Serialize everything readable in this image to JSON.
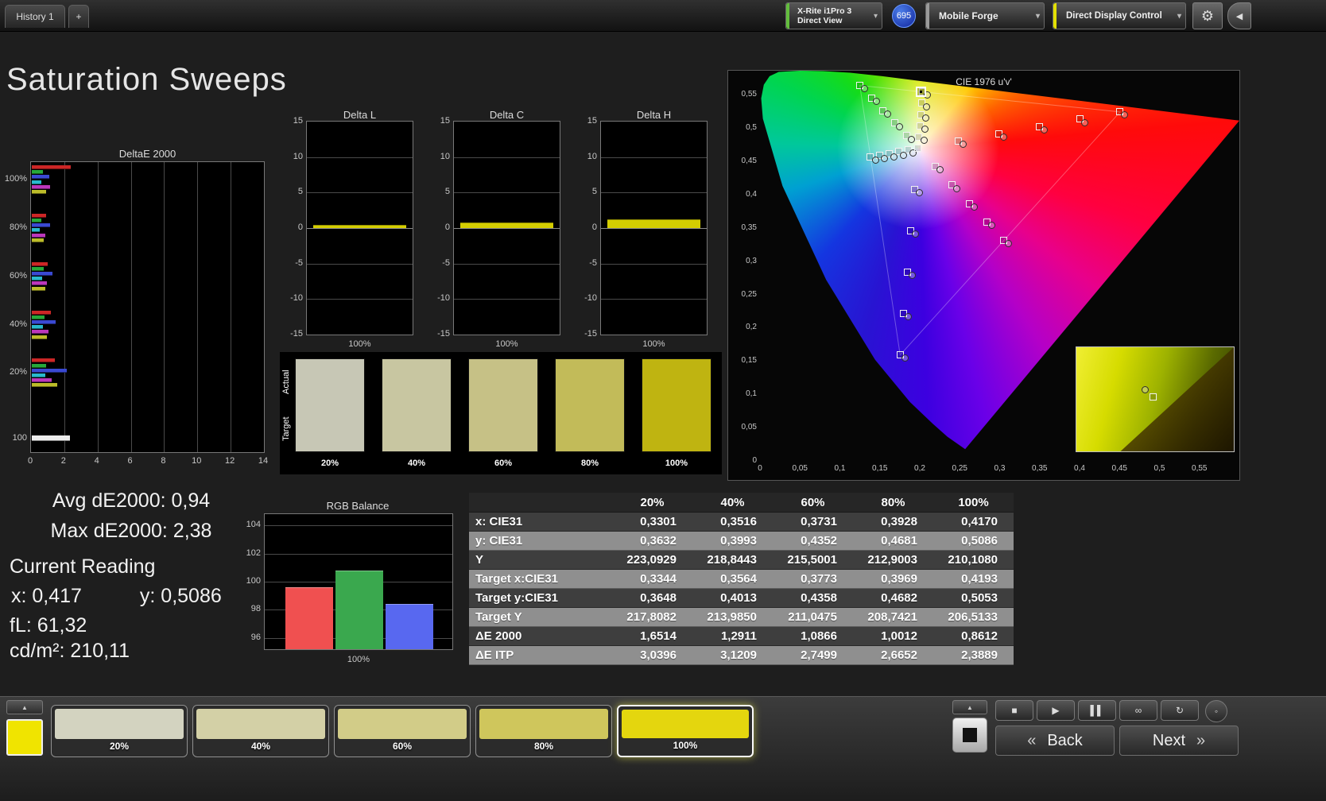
{
  "colors": {
    "meter_accent": "#62bd3c",
    "source_accent": "#9a9a9a",
    "workflow_accent": "#e3e000",
    "current_selection": "#f0e400"
  },
  "top_bar": {
    "tab": "History 1",
    "new_tab": "+",
    "meter_line1": "X-Rite i1Pro 3",
    "meter_line2": "Direct View",
    "badge": "695",
    "source": "Mobile Forge",
    "workflow": "Direct Display Control",
    "chevron": "▾",
    "gear": "⚙",
    "collapse": "◀"
  },
  "page_title": "Saturation Sweeps",
  "readings": {
    "avg": "Avg dE2000: 0,94",
    "max": "Max dE2000: 2,38",
    "current_title": "Current Reading",
    "x": "x: 0,417",
    "y": "y: 0,5086",
    "fl": "fL: 61,32",
    "cdm2": "cd/m²: 210,11"
  },
  "swatches": {
    "row_labels": [
      "Actual",
      "Target"
    ],
    "items": [
      {
        "label": "20%",
        "color": "#c7c7b5"
      },
      {
        "label": "40%",
        "color": "#c8c6a1"
      },
      {
        "label": "60%",
        "color": "#c6c186"
      },
      {
        "label": "80%",
        "color": "#c2bb59"
      },
      {
        "label": "100%",
        "color": "#bfb411"
      }
    ]
  },
  "chart_data": [
    {
      "id": "deltae2000",
      "type": "bar",
      "title": "DeltaE 2000",
      "orientation": "horizontal",
      "xlim": [
        0,
        14
      ],
      "xticks": [
        0,
        2,
        4,
        6,
        8,
        10,
        12,
        14
      ],
      "series_colors": [
        "#cc2626",
        "#27a839",
        "#3a49d2",
        "#28b9cc",
        "#bb37bb",
        "#bcbc29"
      ],
      "groups": [
        {
          "label": "100%",
          "values": [
            2.35,
            0.65,
            1.05,
            0.55,
            1.1,
            0.86
          ]
        },
        {
          "label": "80%",
          "values": [
            0.85,
            0.55,
            1.1,
            0.5,
            0.8,
            0.7
          ]
        },
        {
          "label": "60%",
          "values": [
            0.95,
            0.7,
            1.25,
            0.6,
            0.9,
            0.8
          ]
        },
        {
          "label": "40%",
          "values": [
            1.15,
            0.75,
            1.45,
            0.65,
            1.0,
            0.9
          ]
        },
        {
          "label": "20%",
          "values": [
            1.4,
            0.85,
            2.1,
            0.8,
            1.2,
            1.55
          ]
        },
        {
          "label": "100",
          "values": [
            2.3
          ],
          "colors": [
            "#ececec"
          ]
        }
      ]
    },
    {
      "id": "deltaL",
      "type": "bar",
      "title": "Delta L",
      "ylim": [
        -15,
        15
      ],
      "yticks": [
        15,
        10,
        5,
        0,
        -5,
        -10,
        -15
      ],
      "xlabel": "100%",
      "values": [
        0.4
      ],
      "bar_color": "#d4cd00"
    },
    {
      "id": "deltaC",
      "type": "bar",
      "title": "Delta C",
      "ylim": [
        -15,
        15
      ],
      "yticks": [
        15,
        10,
        5,
        0,
        -5,
        -10,
        -15
      ],
      "xlabel": "100%",
      "values": [
        0.8
      ],
      "bar_color": "#d4cd00"
    },
    {
      "id": "deltaH",
      "type": "bar",
      "title": "Delta H",
      "ylim": [
        -15,
        15
      ],
      "yticks": [
        15,
        10,
        5,
        0,
        -5,
        -10,
        -15
      ],
      "xlabel": "100%",
      "values": [
        1.2
      ],
      "bar_color": "#d4cd00"
    },
    {
      "id": "rgb_balance",
      "type": "bar",
      "title": "RGB Balance",
      "ylim": [
        95.2,
        104.8
      ],
      "yticks": [
        104,
        102,
        100,
        98,
        96
      ],
      "xlabel": "100%",
      "categories": [
        "Red",
        "Green",
        "Blue"
      ],
      "values": [
        99.6,
        100.8,
        98.4
      ],
      "colors": [
        "#f05050",
        "#3aa84e",
        "#5868f0"
      ]
    },
    {
      "id": "cie",
      "type": "scatter",
      "title": "CIE 1976 u'v'",
      "axis_ticks": [
        "0",
        "0,05",
        "0,1",
        "0,15",
        "0,2",
        "0,25",
        "0,3",
        "0,35",
        "0,4",
        "0,45",
        "0,5",
        "0,55"
      ],
      "u_range": [
        0,
        0.6
      ],
      "v_range": [
        0,
        0.585
      ],
      "white_point": {
        "u": 0.1978,
        "v": 0.4683
      },
      "sweeps": [
        {
          "name": "red",
          "points": [
            [
              0.2484,
              0.4792
            ],
            [
              0.299,
              0.4901
            ],
            [
              0.3495,
              0.5011
            ],
            [
              0.4001,
              0.512
            ],
            [
              0.4507,
              0.5229
            ]
          ]
        },
        {
          "name": "green",
          "points": [
            [
              0.1832,
              0.4871
            ],
            [
              0.1687,
              0.506
            ],
            [
              0.1541,
              0.5248
            ],
            [
              0.1396,
              0.5437
            ],
            [
              0.125,
              0.5625
            ]
          ]
        },
        {
          "name": "blue",
          "points": [
            [
              0.1933,
              0.4062
            ],
            [
              0.1888,
              0.3441
            ],
            [
              0.1844,
              0.2821
            ],
            [
              0.1799,
              0.22
            ],
            [
              0.1754,
              0.1579
            ]
          ]
        },
        {
          "name": "cyan",
          "points": [
            [
              0.1859,
              0.4657
            ],
            [
              0.174,
              0.4631
            ],
            [
              0.1621,
              0.4606
            ],
            [
              0.1502,
              0.458
            ],
            [
              0.1383,
              0.4554
            ]
          ]
        },
        {
          "name": "magenta",
          "points": [
            [
              0.2192,
              0.4406
            ],
            [
              0.2407,
              0.4129
            ],
            [
              0.2621,
              0.3851
            ],
            [
              0.2836,
              0.3574
            ],
            [
              0.305,
              0.3297
            ]
          ]
        },
        {
          "name": "yellow",
          "points": [
            [
              0.199,
              0.4852
            ],
            [
              0.2002,
              0.5021
            ],
            [
              0.2015,
              0.519
            ],
            [
              0.2027,
              0.536
            ],
            [
              0.2039,
              0.5529
            ]
          ]
        }
      ],
      "current": {
        "u": 0.2017,
        "v": 0.5535
      },
      "inset": {
        "circle": [
          0.44,
          0.41
        ],
        "square": [
          0.49,
          0.48
        ]
      }
    }
  ],
  "table": {
    "headers": [
      "",
      "20%",
      "40%",
      "60%",
      "80%",
      "100%"
    ],
    "rows": [
      {
        "label": "x: CIE31",
        "values": [
          "0,3301",
          "0,3516",
          "0,3731",
          "0,3928",
          "0,4170"
        ]
      },
      {
        "label": "y: CIE31",
        "values": [
          "0,3632",
          "0,3993",
          "0,4352",
          "0,4681",
          "0,5086"
        ]
      },
      {
        "label": "Y",
        "values": [
          "223,0929",
          "218,8443",
          "215,5001",
          "212,9003",
          "210,1080"
        ]
      },
      {
        "label": "Target x:CIE31",
        "values": [
          "0,3344",
          "0,3564",
          "0,3773",
          "0,3969",
          "0,4193"
        ]
      },
      {
        "label": "Target y:CIE31",
        "values": [
          "0,3648",
          "0,4013",
          "0,4358",
          "0,4682",
          "0,5053"
        ]
      },
      {
        "label": "Target Y",
        "values": [
          "217,8082",
          "213,9850",
          "211,0475",
          "208,7421",
          "206,5133"
        ]
      },
      {
        "label": "ΔE 2000",
        "values": [
          "1,6514",
          "1,2911",
          "1,0866",
          "1,0012",
          "0,8612"
        ]
      },
      {
        "label": "ΔE ITP",
        "values": [
          "3,0396",
          "3,1209",
          "2,7499",
          "2,6652",
          "2,3889"
        ]
      }
    ]
  },
  "bottom_bar": {
    "scroll_up": "▲",
    "current_color": "#f0e400",
    "swatches": [
      {
        "label": "20%",
        "color": "#d3d3c0"
      },
      {
        "label": "40%",
        "color": "#d3d0a6"
      },
      {
        "label": "60%",
        "color": "#d2cc88"
      },
      {
        "label": "80%",
        "color": "#cfc65c"
      },
      {
        "label": "100%",
        "color": "#e4d60e",
        "selected": true
      }
    ],
    "transport": [
      {
        "name": "stop",
        "glyph": "■"
      },
      {
        "name": "play",
        "glyph": "▶"
      },
      {
        "name": "pause",
        "glyph": "▌▌"
      },
      {
        "name": "loop-infinite",
        "glyph": "∞"
      },
      {
        "name": "refresh",
        "glyph": "↻"
      }
    ],
    "back_chevron": "«",
    "back": "Back",
    "next": "Next",
    "next_chevron": "»"
  }
}
